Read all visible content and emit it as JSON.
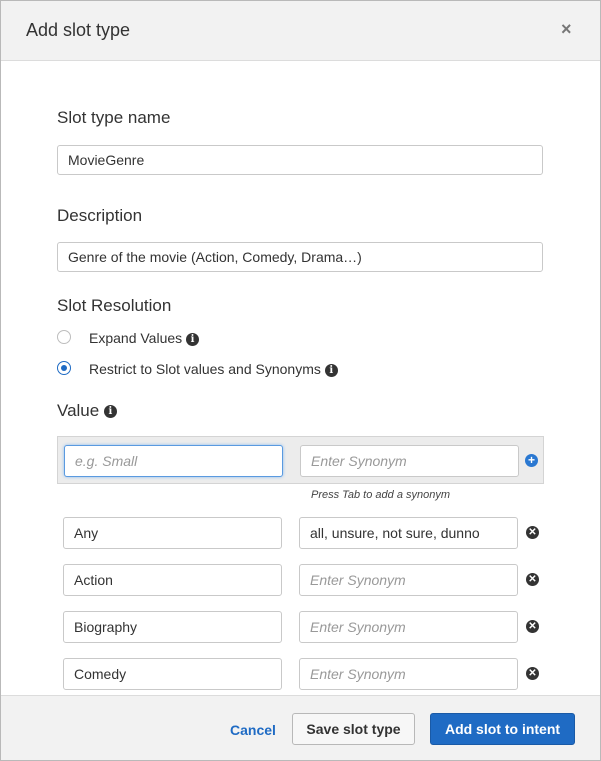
{
  "dialog": {
    "title": "Add slot type",
    "close_symbol": "×"
  },
  "slot_type_name": {
    "label": "Slot type name",
    "value": "MovieGenre"
  },
  "description": {
    "label": "Description",
    "value": "Genre of the movie (Action, Comedy, Drama…)"
  },
  "slot_resolution": {
    "label": "Slot Resolution",
    "options": [
      {
        "label": "Expand Values",
        "selected": false
      },
      {
        "label": "Restrict to Slot values and Synonyms",
        "selected": true
      }
    ]
  },
  "values_section": {
    "label": "Value",
    "new_value_placeholder": "e.g. Small",
    "new_synonym_placeholder": "Enter Synonym",
    "hint": "Press Tab to add a synonym",
    "rows": [
      {
        "value": "Any",
        "synonyms": "all, unsure, not sure, dunno"
      },
      {
        "value": "Action",
        "synonyms": ""
      },
      {
        "value": "Biography",
        "synonyms": ""
      },
      {
        "value": "Comedy",
        "synonyms": ""
      }
    ]
  },
  "footer": {
    "cancel_label": "Cancel",
    "save_label": "Save slot type",
    "add_label": "Add slot to intent"
  },
  "icons": {
    "info": "info-icon",
    "add": "plus-circle-icon",
    "remove": "x-circle-icon",
    "close": "close-icon"
  },
  "colors": {
    "accent": "#1f6bc4",
    "header_bg": "#f2f2f2"
  }
}
